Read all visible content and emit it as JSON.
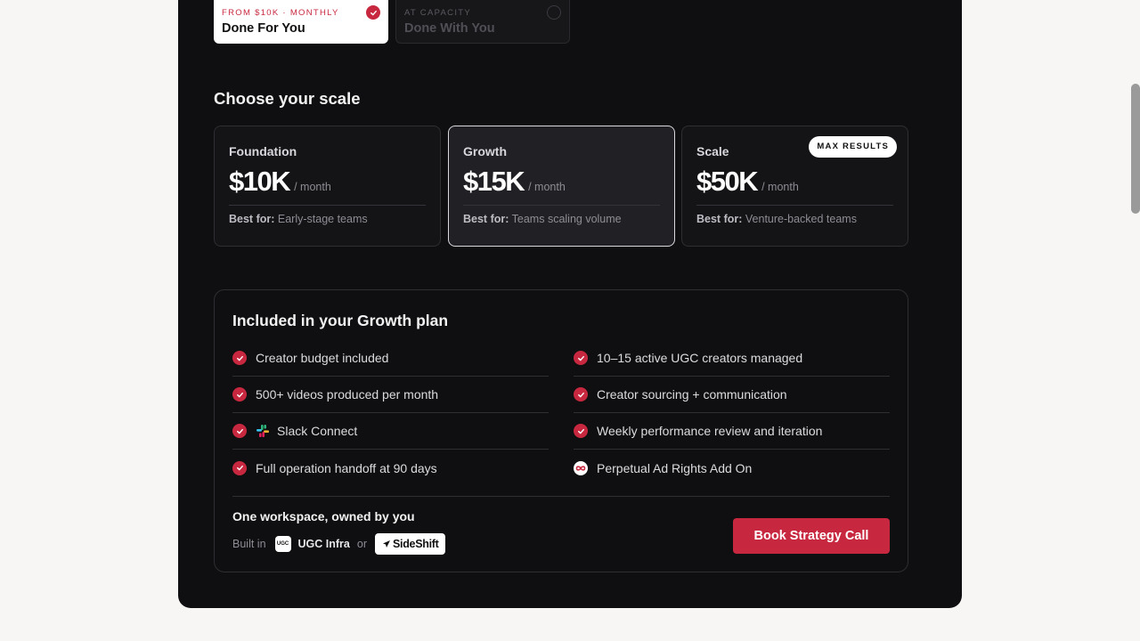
{
  "service_options": [
    {
      "kicker": "FROM $10K · MONTHLY",
      "name": "Done For You",
      "selected": true
    },
    {
      "kicker": "AT CAPACITY",
      "name": "Done With You",
      "selected": false
    }
  ],
  "scale": {
    "heading": "Choose your scale",
    "tiers": [
      {
        "name": "Foundation",
        "price": "$10K",
        "period": "/ month",
        "best_label": "Best for:",
        "best_value": "Early-stage teams",
        "active": false
      },
      {
        "name": "Growth",
        "price": "$15K",
        "period": "/ month",
        "best_label": "Best for:",
        "best_value": "Teams scaling volume",
        "active": true
      },
      {
        "name": "Scale",
        "price": "$50K",
        "period": "/ month",
        "best_label": "Best for:",
        "best_value": "Venture-backed teams",
        "active": false,
        "badge": "MAX RESULTS"
      }
    ]
  },
  "included": {
    "title": "Included in your Growth plan",
    "left": [
      {
        "text": "Creator budget included",
        "icon": "check-icon"
      },
      {
        "text": "500+ videos produced per month",
        "icon": "check-icon"
      },
      {
        "text": "Slack Connect",
        "icon": "check-icon",
        "extra_icon": "slack-icon"
      },
      {
        "text": "Full operation handoff at 90 days",
        "icon": "check-icon"
      }
    ],
    "right": [
      {
        "text": "10–15 active UGC creators managed",
        "icon": "check-icon"
      },
      {
        "text": "Creator sourcing + communication",
        "icon": "check-icon"
      },
      {
        "text": "Weekly performance review and iteration",
        "icon": "check-icon"
      },
      {
        "text": "Perpetual Ad Rights Add On",
        "icon": "infinity-icon"
      }
    ]
  },
  "workspace": {
    "title": "One workspace, owned by you",
    "built_in": "Built in",
    "ugc_logo_text": "UGC",
    "ugc_name": "UGC Infra",
    "or": "or",
    "sideshift": "SideShift"
  },
  "cta": {
    "label": "Book Strategy Call"
  },
  "colors": {
    "accent": "#c8283f",
    "panel": "#0f0f11",
    "page": "#f7f6f4"
  }
}
